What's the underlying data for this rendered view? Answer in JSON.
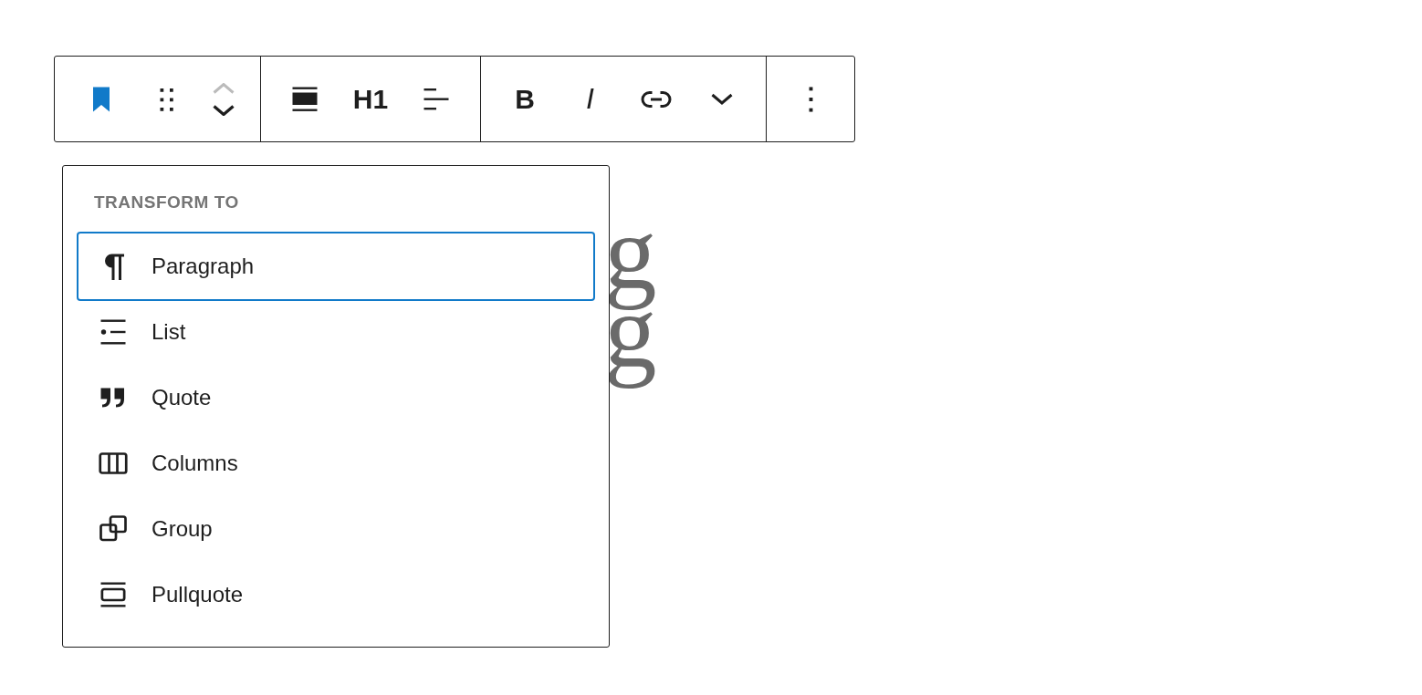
{
  "editor": {
    "heading_fragments": [
      "g",
      "g"
    ]
  },
  "toolbar": {
    "groups": [
      {
        "items": [
          {
            "kind": "block-type"
          },
          {
            "kind": "drag"
          },
          {
            "kind": "mover",
            "up_disabled": true
          }
        ]
      },
      {
        "items": [
          {
            "kind": "align"
          },
          {
            "kind": "heading",
            "label": "H1"
          },
          {
            "kind": "text-align"
          }
        ]
      },
      {
        "items": [
          {
            "kind": "bold",
            "label": "B"
          },
          {
            "kind": "italic",
            "label": "I"
          },
          {
            "kind": "link"
          },
          {
            "kind": "more-caret"
          }
        ]
      },
      {
        "items": [
          {
            "kind": "options"
          }
        ]
      }
    ]
  },
  "transform_menu": {
    "heading": "TRANSFORM TO",
    "items": [
      {
        "kind": "paragraph",
        "label": "Paragraph",
        "selected": true
      },
      {
        "kind": "list",
        "label": "List",
        "selected": false
      },
      {
        "kind": "quote",
        "label": "Quote",
        "selected": false
      },
      {
        "kind": "columns",
        "label": "Columns",
        "selected": false
      },
      {
        "kind": "group",
        "label": "Group",
        "selected": false
      },
      {
        "kind": "pullquote",
        "label": "Pullquote",
        "selected": false
      }
    ]
  }
}
